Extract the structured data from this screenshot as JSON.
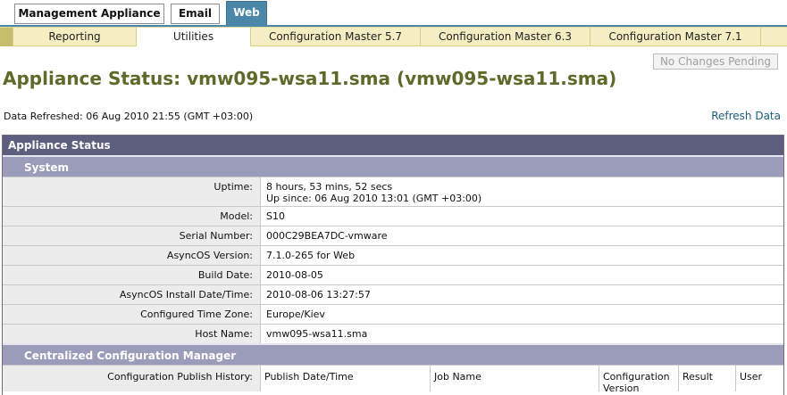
{
  "top_tabs": [
    "Management Appliance",
    "Email",
    "Web"
  ],
  "subnav": [
    "Reporting",
    "Utilities",
    "Configuration Master 5.7",
    "Configuration Master 6.3",
    "Configuration Master 7.1"
  ],
  "pending_button": "No Changes Pending",
  "page_title": "Appliance Status: vmw095-wsa11.sma (vmw095-wsa11.sma)",
  "data_refreshed": "Data Refreshed: 06 Aug 2010 21:55 (GMT +03:00)",
  "refresh_link": "Refresh Data",
  "panel": {
    "title": "Appliance Status",
    "system": {
      "title": "System",
      "uptime_label": "Uptime:",
      "uptime_line1": "8 hours, 53 mins, 52 secs",
      "uptime_line2": "Up since: 06 Aug 2010 13:01 (GMT +03:00)",
      "rows": [
        {
          "label": "Model:",
          "value": "S10"
        },
        {
          "label": "Serial Number:",
          "value": "000C29BEA7DC-vmware"
        },
        {
          "label": "AsyncOS Version:",
          "value": "7.1.0-265 for Web"
        },
        {
          "label": "Build Date:",
          "value": "2010-08-05"
        },
        {
          "label": "AsyncOS Install Date/Time:",
          "value": "2010-08-06 13:27:57"
        },
        {
          "label": "Configured Time Zone:",
          "value": "Europe/Kiev"
        },
        {
          "label": "Host Name:",
          "value": "vmw095-wsa11.sma"
        }
      ]
    },
    "ccm": {
      "title": "Centralized Configuration Manager",
      "publish_label": "Configuration Publish History:",
      "columns": [
        "Publish Date/Time",
        "Job Name",
        "Configuration Version",
        "Result",
        "User"
      ]
    }
  }
}
